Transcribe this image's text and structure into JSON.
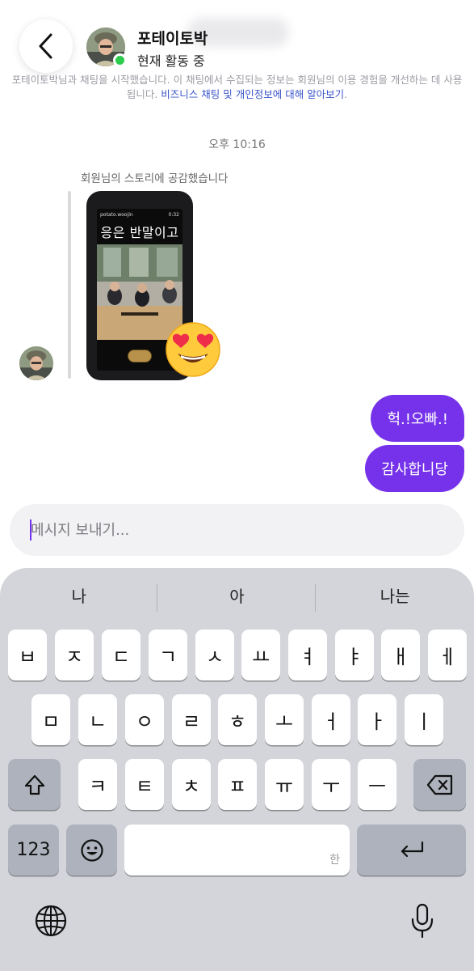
{
  "header": {
    "contact_name": "포테이토박",
    "status": "현재 활동 중",
    "disclaimer_text": "포테이토박님과 채팅을 시작했습니다. 이 채팅에서 수집되는 정보는 회원님의 이용 경험을 개선하는 데 사용됩니다. ",
    "disclaimer_link": "비즈니스 채팅 및 개인정보에 대해 알아보기",
    "disclaimer_end": "."
  },
  "thread": {
    "timestamp": "오후 10:16",
    "story_caption": "회원님의 스토리에 공감했습니다",
    "story": {
      "handle": "potato.woojin",
      "time": "0:32",
      "overlay_text": "응은 반말이고"
    },
    "reaction_icon": "heart-eyes-emoji",
    "sent_messages": [
      "헉.!오빠.!",
      "감사합니당"
    ]
  },
  "composer": {
    "placeholder": "메시지 보내기..."
  },
  "keyboard": {
    "suggestions": [
      "나",
      "아",
      "나는"
    ],
    "row1": [
      "ㅂ",
      "ㅈ",
      "ㄷ",
      "ㄱ",
      "ㅅ",
      "ㅛ",
      "ㅕ",
      "ㅑ",
      "ㅐ",
      "ㅔ"
    ],
    "row2": [
      "ㅁ",
      "ㄴ",
      "ㅇ",
      "ㄹ",
      "ㅎ",
      "ㅗ",
      "ㅓ",
      "ㅏ",
      "ㅣ"
    ],
    "row3": [
      "ㅋ",
      "ㅌ",
      "ㅊ",
      "ㅍ",
      "ㅠ",
      "ㅜ",
      "ㅡ"
    ],
    "numbers_label": "123",
    "space_hint": "한"
  },
  "colors": {
    "accent": "#7532ea",
    "online": "#2bcb4b",
    "link": "#3b55c9",
    "keyboard_bg": "#d3d5db"
  }
}
